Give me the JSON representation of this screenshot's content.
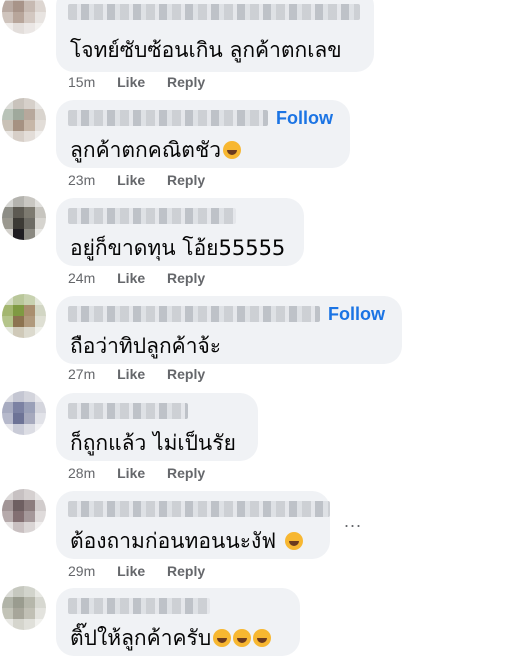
{
  "actions": {
    "like": "Like",
    "reply": "Reply",
    "follow": "Follow",
    "more": "..."
  },
  "comments": [
    {
      "text": "โจทย์ซับซ้อนเกิน ลูกค้าตกเลข",
      "time": "15m",
      "follow": false,
      "emojis": 0
    },
    {
      "text": "ลูกค้าตกคณิตชัว",
      "time": "23m",
      "follow": true,
      "emojis": 1
    },
    {
      "text": "อยู่ก็ขาดทุน โอ้ย55555",
      "time": "24m",
      "follow": false,
      "emojis": 0
    },
    {
      "text": "ถือว่าทิปลูกค้าจ้ะ",
      "time": "27m",
      "follow": true,
      "emojis": 0
    },
    {
      "text": "ก็ถูกแล้ว ไม่เป็นรัย",
      "time": "28m",
      "follow": false,
      "emojis": 0
    },
    {
      "text": "ต้องถามก่อนทอนนะงัฟ",
      "time": "29m",
      "follow": false,
      "emojis": 1
    },
    {
      "text": "ติ๊ปให้ลูกค้าครับ",
      "time": "29m",
      "follow": false,
      "emojis": 3
    }
  ]
}
